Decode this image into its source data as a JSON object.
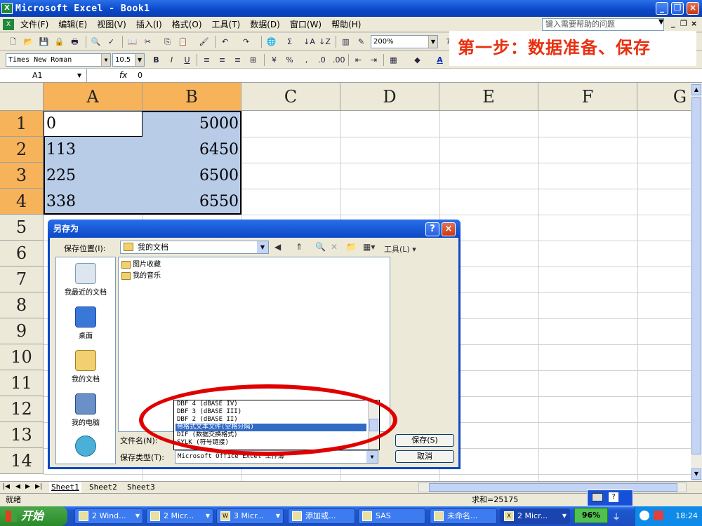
{
  "window": {
    "title": "Microsoft Excel - Book1",
    "app_icon": "excel-icon"
  },
  "menu": {
    "items": [
      "文件(F)",
      "编辑(E)",
      "视图(V)",
      "插入(I)",
      "格式(O)",
      "工具(T)",
      "数据(D)",
      "窗口(W)",
      "帮助(H)"
    ],
    "help_placeholder": "键入需要帮助的问题"
  },
  "toolbar": {
    "zoom": "200%",
    "font": "Times New Roman",
    "font_size": "10.5"
  },
  "annotation": {
    "text": "第一步：数据准备、保存",
    "color": "#e83010"
  },
  "formula_bar": {
    "name_box": "A1",
    "fx": "fx",
    "value": "0"
  },
  "sheet": {
    "columns": [
      "A",
      "B",
      "C",
      "D",
      "E",
      "F",
      "G"
    ],
    "rows": [
      "1",
      "2",
      "3",
      "4",
      "5",
      "6",
      "7",
      "8",
      "9",
      "10",
      "11",
      "12",
      "13",
      "14"
    ],
    "cells": {
      "A1": "0",
      "B1": "5000",
      "A2": "113",
      "B2": "6450",
      "A3": "225",
      "B3": "6500",
      "A4": "338",
      "B4": "6550"
    },
    "selection_color": "#b8cce8",
    "header_selected_color": "#f7b35a"
  },
  "tabs": [
    "Sheet1",
    "Sheet2",
    "Sheet3"
  ],
  "status": {
    "ready": "就绪",
    "sum": "求和=25175"
  },
  "taskbar": {
    "start": "开始",
    "tasks": [
      "2 Wind...",
      "2 Micr...",
      "3 Micr...",
      "添加或...",
      "SAS",
      "未命名...",
      "2 Micr..."
    ],
    "battery": "96%",
    "clock": "18:24"
  },
  "dialog": {
    "title": "另存为",
    "look_in_label": "保存位置(I):",
    "look_in_value": "我的文档",
    "tools_label": "工具(L)",
    "places": [
      "我最近的文档",
      "桌面",
      "我的文档",
      "我的电脑"
    ],
    "files": [
      "图片收藏",
      "我的音乐"
    ],
    "filename_label": "文件名(N):",
    "filetype_label": "保存类型(T):",
    "filetype_value": "Microsoft Office Excel 工作簿",
    "filetype_options": [
      "DBF 4 (dBASE IV)",
      "DBF 3 (dBASE III)",
      "DBF 2 (dBASE II)",
      "带格式文本文件(空格分隔)",
      "DIF (数据交换格式)",
      "SYLK (符号链接)"
    ],
    "selected_option_index": 3,
    "save_label": "保存(S)",
    "cancel_label": "取消"
  }
}
